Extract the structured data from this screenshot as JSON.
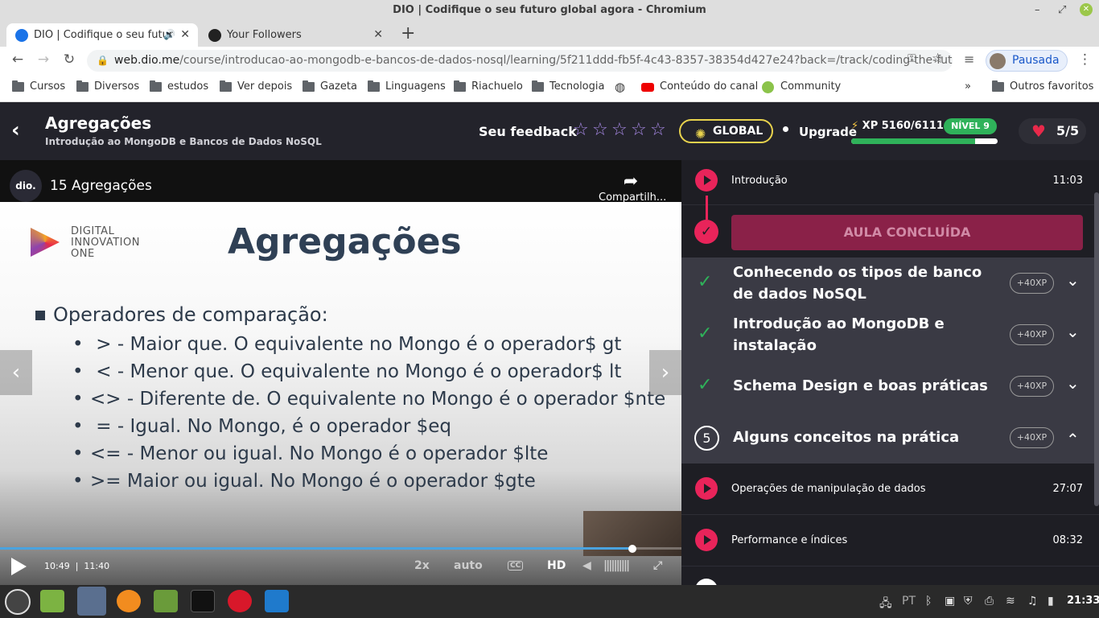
{
  "window": {
    "title": "DIO | Codifique o seu futuro global agora - Chromium",
    "controls": [
      "–",
      "⤢",
      "✕"
    ]
  },
  "tabs": [
    {
      "title": "DIO | Codifique o seu futur",
      "active": true
    },
    {
      "title": "Your Followers",
      "active": false
    }
  ],
  "new_tab": "+",
  "address": {
    "host": "web.dio.me",
    "path": "/course/introducao-ao-mongodb-e-bancos-de-dados-nosql/learning/5f211ddd-fb5f-4c43-8357-38354d427e24?back=/track/coding-the-future..."
  },
  "profile": {
    "label": "Pausada"
  },
  "bookmarks": [
    "Cursos",
    "Diversos",
    "estudos",
    "Ver depois",
    "Gazeta",
    "Linguagens",
    "Riachuelo",
    "Tecnologia",
    "Conteúdo do canal",
    "Community"
  ],
  "bookmarks_more": "»",
  "other_bookmarks": "Outros favoritos",
  "header": {
    "back": "‹",
    "title": "Agregações",
    "subtitle": "Introdução ao MongoDB e Bancos de Dados NoSQL",
    "feedback_label": "Seu feedback",
    "stars": 5,
    "global_label": "GLOBAL",
    "upgrade_label": "Upgrade",
    "xp_label": "XP 5160/6111",
    "xp_progress": 0.844,
    "level_label": "NÍVEL 9",
    "lives_label": "5/5"
  },
  "video": {
    "logo": "dio.",
    "title": "15 Agregações",
    "share_label": "Compartilh...",
    "slide": {
      "brand": [
        "DIGITAL",
        "INNOVATION",
        "ONE"
      ],
      "title": "Agregações",
      "heading": "Operadores de comparação:",
      "items": [
        {
          "bullet": "•",
          "text": " > - Maior que. O equivalente no Mongo é o operador$ gt"
        },
        {
          "bullet": "•",
          "text": " < - Menor que. O equivalente no Mongo é o operador$ lt"
        },
        {
          "bullet": "•",
          "text": "<> - Diferente de. O equivalente no Mongo é o operador $nte"
        },
        {
          "bullet": "•",
          "text": " = - Igual. No Mongo, é o operador $eq"
        },
        {
          "bullet": "•",
          "text": "<= - Menor ou igual. No Mongo é o operador $lte"
        },
        {
          "bullet": "•",
          "text": ">= Maior ou igual. No Mongo é o operador $gte"
        }
      ]
    },
    "current_time": "10:49",
    "duration": "11:40",
    "progress": 0.928,
    "speed": "2x",
    "quality_auto": "auto",
    "cc": "CC",
    "hd": "HD"
  },
  "sidebar": {
    "lessons_top": [
      {
        "name": "Introdução",
        "duration": "11:03"
      }
    ],
    "done_label": "AULA CONCLUÍDA",
    "modules": [
      {
        "title": "Conhecendo os tipos de banco de dados NoSQL",
        "xp": "+40XP",
        "state": "done"
      },
      {
        "title": "Introdução ao MongoDB e instalação",
        "xp": "+40XP",
        "state": "done"
      },
      {
        "title": "Schema Design e boas práticas",
        "xp": "+40XP",
        "state": "done"
      },
      {
        "title": "Alguns conceitos na prática",
        "xp": "+40XP",
        "state": "open",
        "number": "5"
      }
    ],
    "lessons_bottom": [
      {
        "name": "Operações de manipulação de dados",
        "duration": "27:07"
      },
      {
        "name": "Performance e índices",
        "duration": "08:32"
      }
    ]
  },
  "taskbar": {
    "language": "PT",
    "clock": "21:33"
  }
}
